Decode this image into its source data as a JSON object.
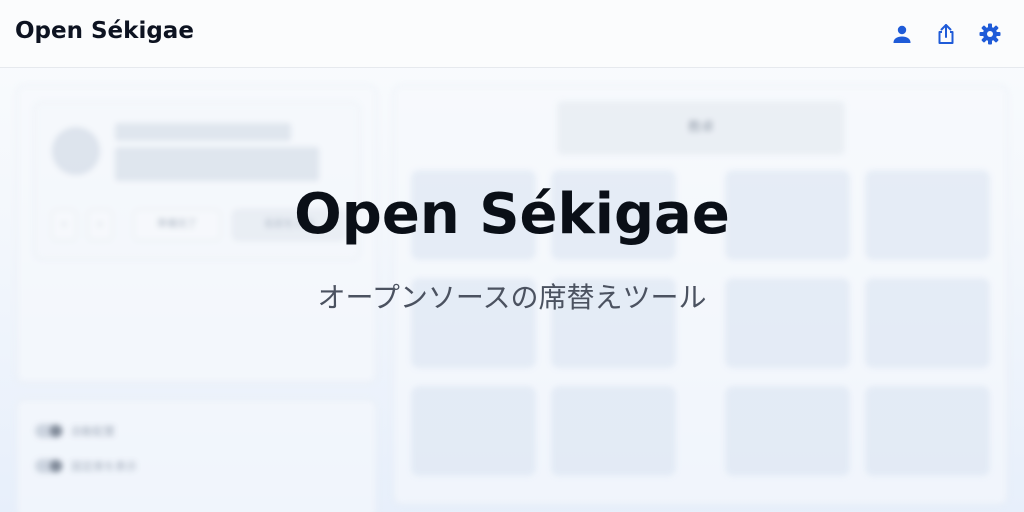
{
  "header": {
    "title": "Open Sékigae",
    "icons": [
      "user-icon",
      "share-icon",
      "gear-icon"
    ],
    "accent_color": "#1f5bd8"
  },
  "background": {
    "left_card": {
      "prev_label": "‹",
      "next_label": "›",
      "button_1": "準備完了",
      "button_2": "名前を入力"
    },
    "toggles": [
      {
        "label": "自動配置"
      },
      {
        "label": "固定席を表示"
      }
    ],
    "desk_label": "教卓"
  },
  "hero": {
    "title": "Open Sékigae",
    "subtitle": "オープンソースの席替えツール"
  }
}
